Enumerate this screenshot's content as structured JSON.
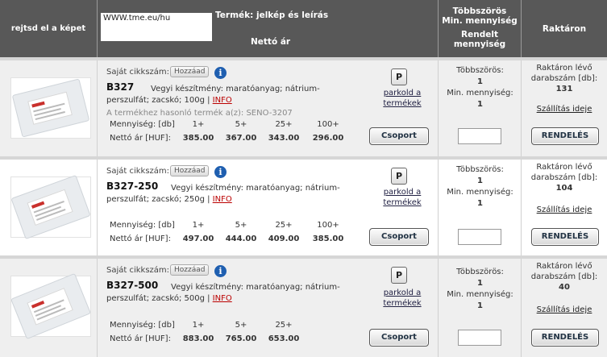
{
  "header": {
    "hide_images": "rejtsd el a képet",
    "url_box": "WWW.tme.eu/hu",
    "product_title": "Termék: jelkép és leírás",
    "net_price": "Nettó ár",
    "multiple": "Többszörös",
    "min_qty": "Min. mennyiség",
    "ordered": "Rendelt",
    "ordered2": "mennyiség",
    "stock": "Raktáron"
  },
  "labels": {
    "own_code": "Saját cikkszám:",
    "add": "Hozzáad",
    "info": "INFO",
    "quantity": "Mennyiség: [db]",
    "net_price": "Nettó ár [HUF]:",
    "park1": "parkold a",
    "park2": "termékek",
    "p": "P",
    "group": "Csoport",
    "multiple": "Többszörös:",
    "min_qty": "Min. mennyiség:",
    "stock1": "Raktáron lévő",
    "stock2": "darabszám [db]:",
    "shipping": "Szállítás ideje",
    "order": "RENDELÉS"
  },
  "products": [
    {
      "code": "B327",
      "desc_a": "Vegyi készítmény: maratóanyag; nátrium-",
      "desc_b": "perszulfát; zacskó; 100g |",
      "similar": "A termékhez hasonló termék a(z): SENO-3207",
      "qty": [
        "1+",
        "5+",
        "25+",
        "100+"
      ],
      "prices": [
        "385.00",
        "367.00",
        "343.00",
        "296.00"
      ],
      "multiple": "1",
      "min_qty": "1",
      "stock": "131"
    },
    {
      "code": "B327-250",
      "desc_a": "Vegyi készítmény: maratóanyag; nátrium-",
      "desc_b": "perszulfát; zacskó; 250g |",
      "similar": "",
      "qty": [
        "1+",
        "5+",
        "25+",
        "100+"
      ],
      "prices": [
        "497.00",
        "444.00",
        "409.00",
        "385.00"
      ],
      "multiple": "1",
      "min_qty": "1",
      "stock": "104"
    },
    {
      "code": "B327-500",
      "desc_a": "Vegyi készítmény: maratóanyag; nátrium-",
      "desc_b": "perszulfát; zacskó; 500g |",
      "similar": "",
      "qty": [
        "1+",
        "5+",
        "25+",
        ""
      ],
      "prices": [
        "883.00",
        "765.00",
        "653.00",
        ""
      ],
      "multiple": "1",
      "min_qty": "1",
      "stock": "40"
    }
  ]
}
